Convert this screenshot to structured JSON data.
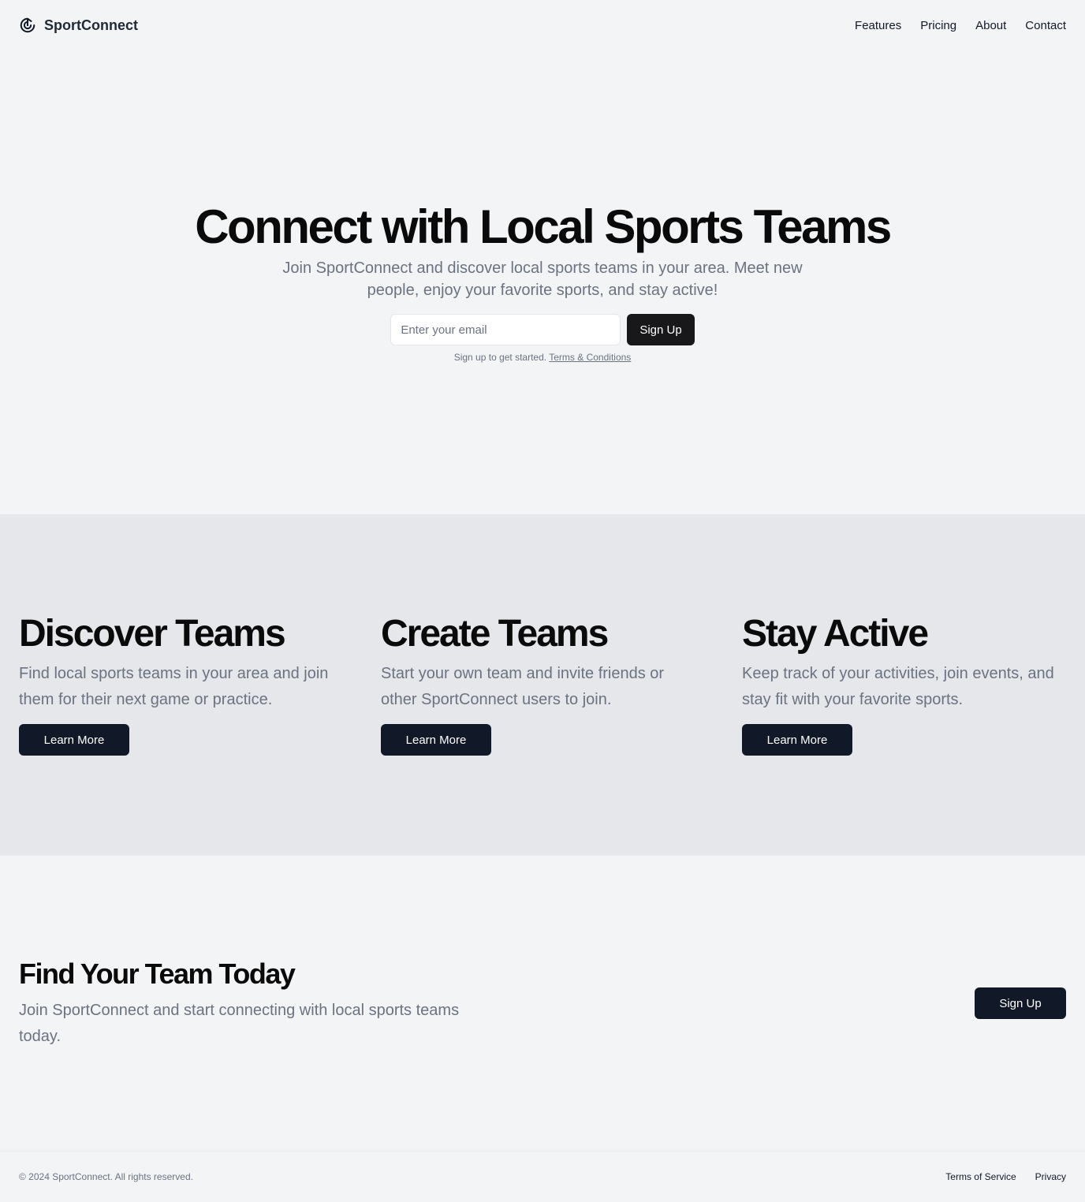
{
  "header": {
    "brand": "SportConnect",
    "brand_icon": "target-play-icon",
    "nav": [
      "Features",
      "Pricing",
      "About",
      "Contact"
    ]
  },
  "hero": {
    "title": "Connect with Local Sports Teams",
    "subtitle": "Join SportConnect and discover local sports teams in your area. Meet new people, enjoy your favorite sports, and stay active!",
    "email_placeholder": "Enter your email",
    "email_value": "",
    "signup_label": "Sign Up",
    "note": "Sign up to get started.",
    "terms_label": "Terms & Conditions"
  },
  "features": [
    {
      "title": "Discover Teams",
      "description": "Find local sports teams in your area and join them for their next game or practice.",
      "button": "Learn More"
    },
    {
      "title": "Create Teams",
      "description": "Start your own team and invite friends or other SportConnect users to join.",
      "button": "Learn More"
    },
    {
      "title": "Stay Active",
      "description": "Keep track of your activities, join events, and stay fit with your favorite sports.",
      "button": "Learn More"
    }
  ],
  "cta": {
    "title": "Find Your Team Today",
    "subtitle": "Join SportConnect and start connecting with local sports teams today.",
    "button": "Sign Up"
  },
  "footer": {
    "copyright": "© 2024 SportConnect. All rights reserved.",
    "links": [
      "Terms of Service",
      "Privacy"
    ]
  },
  "colors": {
    "page_bg": "#f3f4f6",
    "features_bg": "#e5e7eb",
    "primary_button": "#111827",
    "hero_button": "#18181b",
    "muted_text": "#6b7280"
  }
}
